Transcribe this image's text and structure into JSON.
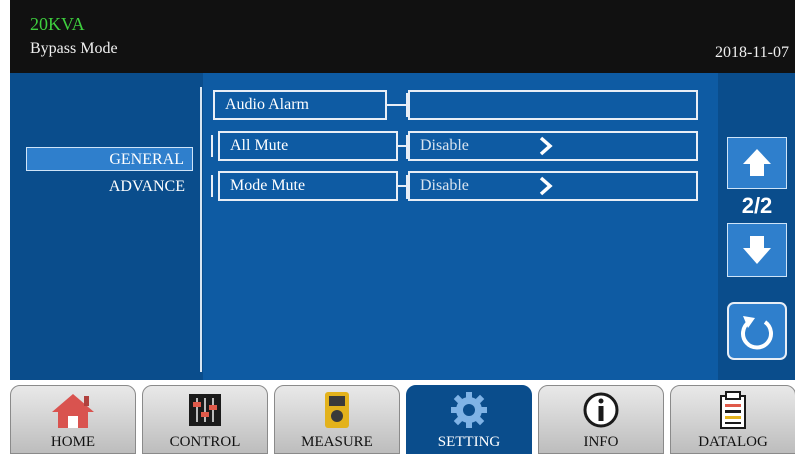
{
  "header": {
    "model": "20KVA",
    "mode": "Bypass Mode",
    "date": "2018-11-07"
  },
  "sidebar": {
    "items": [
      {
        "label": "GENERAL",
        "selected": true
      },
      {
        "label": "ADVANCE",
        "selected": false
      }
    ]
  },
  "settings": {
    "group_label": "Audio Alarm",
    "rows": [
      {
        "label": "All Mute",
        "value": "Disable"
      },
      {
        "label": "Mode Mute",
        "value": "Disable"
      }
    ]
  },
  "pager": {
    "indicator": "2/2"
  },
  "tabs": [
    {
      "label": "HOME",
      "icon": "home-icon",
      "active": false
    },
    {
      "label": "CONTROL",
      "icon": "sliders-icon",
      "active": false
    },
    {
      "label": "MEASURE",
      "icon": "multimeter-icon",
      "active": false
    },
    {
      "label": "SETTING",
      "icon": "gear-icon",
      "active": true
    },
    {
      "label": "INFO",
      "icon": "info-icon",
      "active": false
    },
    {
      "label": "DATALOG",
      "icon": "clipboard-icon",
      "active": false
    }
  ],
  "colors": {
    "background": "#0a4d8c",
    "accent": "#2f7fcc",
    "header": "#111111",
    "model_text": "#3ecf3e"
  }
}
